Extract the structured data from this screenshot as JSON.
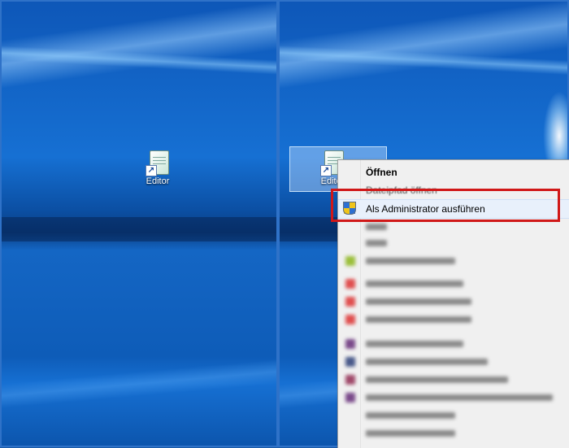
{
  "desktop_left": {
    "icon_label": "Editor"
  },
  "desktop_right": {
    "icon_label": "Editor"
  },
  "context_menu": {
    "open": "Öffnen",
    "open_path": "Dateipfad öffnen",
    "run_as_admin": "Als Administrator ausführen"
  },
  "colors": {
    "highlight_border": "#d01818",
    "desktop_blue": "#1670d3",
    "menu_background": "#f0f0f0"
  }
}
